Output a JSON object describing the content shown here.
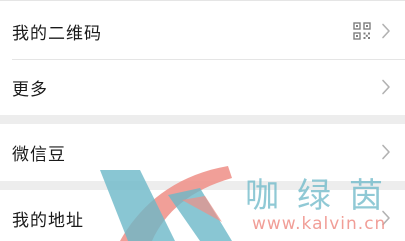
{
  "settings": {
    "items": [
      {
        "label": "我的二维码",
        "icon": "qr-code-icon",
        "has_chevron": true
      },
      {
        "label": "更多",
        "has_chevron": true
      },
      {
        "label": "微信豆",
        "has_chevron": true
      },
      {
        "label": "我的地址",
        "has_chevron": true
      }
    ]
  },
  "watermark": {
    "brand": "咖绿茵",
    "url": "www.kalvin.cn",
    "colors": {
      "teal": "#6bb8c8",
      "pink": "#ef8e86"
    }
  },
  "colors": {
    "background": "#ededed",
    "row": "#ffffff",
    "text": "#1a1a1a",
    "chevron": "#b2b2b2"
  }
}
